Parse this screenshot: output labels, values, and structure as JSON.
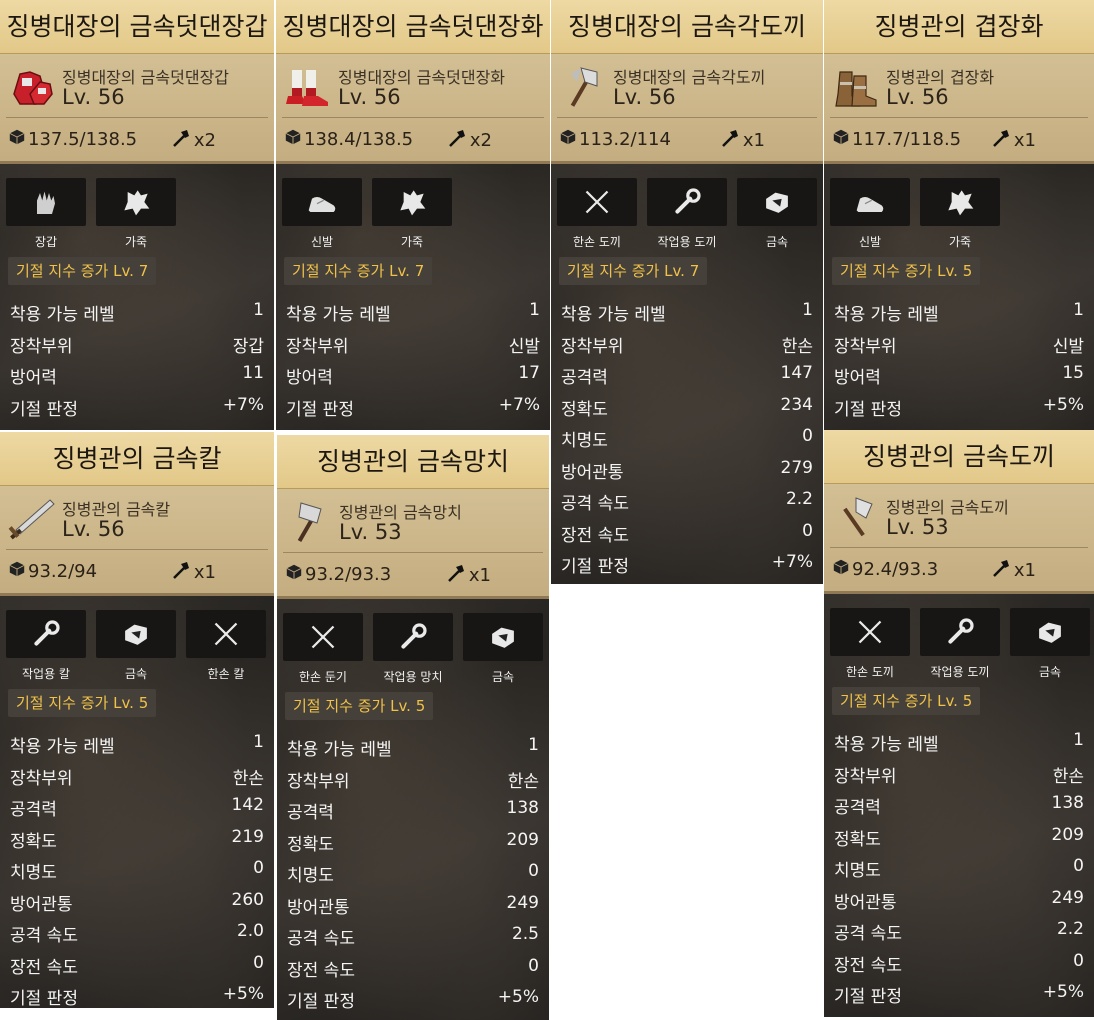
{
  "cards": [
    {
      "title": "징병대장의 금속덧댄장갑",
      "name": "징병대장의 금속덧댄장갑",
      "level": "Lv. 56",
      "weight": "137.5/138.5",
      "count": "x2",
      "icon": "gloves-icon",
      "tags": [
        {
          "icon": "glove-tag-icon",
          "label": "장갑"
        },
        {
          "icon": "leather-icon",
          "label": "가죽"
        }
      ],
      "bonus": "기절 지수 증가 Lv. 7",
      "stats": [
        {
          "k": "착용 가능 레벨",
          "v": "1"
        },
        {
          "k": "장착부위",
          "v": "장갑"
        },
        {
          "k": "방어력",
          "v": "11"
        },
        {
          "k": "기절 판정",
          "v": "+7%"
        }
      ]
    },
    {
      "title": "징병대장의 금속덧댄장화",
      "name": "징병대장의 금속덧댄장화",
      "level": "Lv. 56",
      "weight": "138.4/138.5",
      "count": "x2",
      "icon": "boots-icon",
      "tags": [
        {
          "icon": "shoe-icon",
          "label": "신발"
        },
        {
          "icon": "leather-icon",
          "label": "가죽"
        }
      ],
      "bonus": "기절 지수 증가 Lv. 7",
      "stats": [
        {
          "k": "착용 가능 레벨",
          "v": "1"
        },
        {
          "k": "장착부위",
          "v": "신발"
        },
        {
          "k": "방어력",
          "v": "17"
        },
        {
          "k": "기절 판정",
          "v": "+7%"
        }
      ]
    },
    {
      "title": "징병대장의 금속각도끼",
      "name": "징병대장의 금속각도끼",
      "level": "Lv. 56",
      "weight": "113.2/114",
      "count": "x1",
      "icon": "axe-icon",
      "tags": [
        {
          "icon": "crossed-blades-icon",
          "label": "한손 도끼"
        },
        {
          "icon": "wrench-icon",
          "label": "작업용 도끼"
        },
        {
          "icon": "metal-icon",
          "label": "금속"
        }
      ],
      "bonus": "기절 지수 증가 Lv. 7",
      "stats": [
        {
          "k": "착용 가능 레벨",
          "v": "1"
        },
        {
          "k": "장착부위",
          "v": "한손"
        },
        {
          "k": "공격력",
          "v": "147"
        },
        {
          "k": "정확도",
          "v": "234"
        },
        {
          "k": "치명도",
          "v": "0"
        },
        {
          "k": "방어관통",
          "v": "279"
        },
        {
          "k": "공격 속도",
          "v": "2.2"
        },
        {
          "k": "장전 속도",
          "v": "0"
        },
        {
          "k": "기절 판정",
          "v": "+7%"
        }
      ]
    },
    {
      "title": "징병관의 겹장화",
      "name": "징병관의 겹장화",
      "level": "Lv. 56",
      "weight": "117.7/118.5",
      "count": "x1",
      "icon": "brown-boots-icon",
      "tags": [
        {
          "icon": "shoe-icon",
          "label": "신발"
        },
        {
          "icon": "leather-icon",
          "label": "가죽"
        }
      ],
      "bonus": "기절 지수 증가 Lv. 5",
      "stats": [
        {
          "k": "착용 가능 레벨",
          "v": "1"
        },
        {
          "k": "장착부위",
          "v": "신발"
        },
        {
          "k": "방어력",
          "v": "15"
        },
        {
          "k": "기절 판정",
          "v": "+5%"
        }
      ]
    },
    {
      "title": "징병관의 금속칼",
      "name": "징병관의 금속칼",
      "level": "Lv. 56",
      "weight": "93.2/94",
      "count": "x1",
      "icon": "sword-icon",
      "tags": [
        {
          "icon": "wrench-icon",
          "label": "작업용 칼"
        },
        {
          "icon": "metal-icon",
          "label": "금속"
        },
        {
          "icon": "crossed-blades-icon",
          "label": "한손 칼"
        }
      ],
      "bonus": "기절 지수 증가 Lv. 5",
      "stats": [
        {
          "k": "착용 가능 레벨",
          "v": "1"
        },
        {
          "k": "장착부위",
          "v": "한손"
        },
        {
          "k": "공격력",
          "v": "142"
        },
        {
          "k": "정확도",
          "v": "219"
        },
        {
          "k": "치명도",
          "v": "0"
        },
        {
          "k": "방어관통",
          "v": "260"
        },
        {
          "k": "공격 속도",
          "v": "2.0"
        },
        {
          "k": "장전 속도",
          "v": "0"
        },
        {
          "k": "기절 판정",
          "v": "+5%"
        }
      ]
    },
    {
      "title": "징병관의 금속망치",
      "name": "징병관의 금속망치",
      "level": "Lv. 53",
      "weight": "93.2/93.3",
      "count": "x1",
      "icon": "hammer-icon",
      "tags": [
        {
          "icon": "crossed-blades-icon",
          "label": "한손 둔기"
        },
        {
          "icon": "wrench-icon",
          "label": "작업용 망치"
        },
        {
          "icon": "metal-icon",
          "label": "금속"
        }
      ],
      "bonus": "기절 지수 증가 Lv. 5",
      "stats": [
        {
          "k": "착용 가능 레벨",
          "v": "1"
        },
        {
          "k": "장착부위",
          "v": "한손"
        },
        {
          "k": "공격력",
          "v": "138"
        },
        {
          "k": "정확도",
          "v": "209"
        },
        {
          "k": "치명도",
          "v": "0"
        },
        {
          "k": "방어관통",
          "v": "249"
        },
        {
          "k": "공격 속도",
          "v": "2.5"
        },
        {
          "k": "장전 속도",
          "v": "0"
        },
        {
          "k": "기절 판정",
          "v": "+5%"
        }
      ]
    },
    {
      "title": "징병관의 금속도끼",
      "name": "징병관의 금속도끼",
      "level": "Lv. 53",
      "weight": "92.4/93.3",
      "count": "x1",
      "icon": "small-axe-icon",
      "tags": [
        {
          "icon": "crossed-blades-icon",
          "label": "한손 도끼"
        },
        {
          "icon": "wrench-icon",
          "label": "작업용 도끼"
        },
        {
          "icon": "metal-icon",
          "label": "금속"
        }
      ],
      "bonus": "기절 지수 증가 Lv. 5",
      "stats": [
        {
          "k": "착용 가능 레벨",
          "v": "1"
        },
        {
          "k": "장착부위",
          "v": "한손"
        },
        {
          "k": "공격력",
          "v": "138"
        },
        {
          "k": "정확도",
          "v": "209"
        },
        {
          "k": "치명도",
          "v": "0"
        },
        {
          "k": "방어관통",
          "v": "249"
        },
        {
          "k": "공격 속도",
          "v": "2.2"
        },
        {
          "k": "장전 속도",
          "v": "0"
        },
        {
          "k": "기절 판정",
          "v": "+5%"
        }
      ]
    }
  ],
  "colors": {
    "title_bg": "#eed9a4",
    "header_bg": "#d3bf94",
    "bonus_text": "#f0c24a",
    "panel_bg": "#2a2826"
  }
}
